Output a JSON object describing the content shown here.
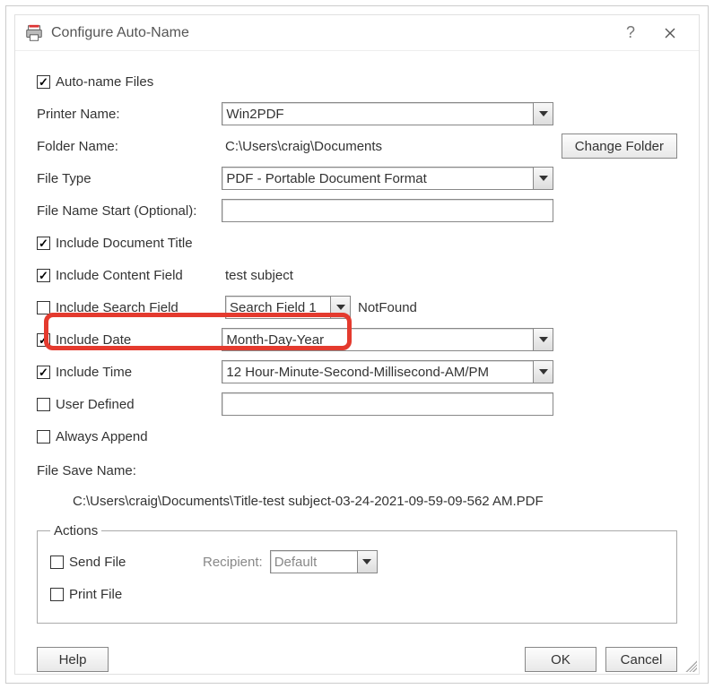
{
  "window": {
    "title": "Configure Auto-Name"
  },
  "fields": {
    "autoNameFiles": {
      "label": "Auto-name Files",
      "checked": true
    },
    "printerName": {
      "label": "Printer Name:",
      "value": "Win2PDF"
    },
    "folderName": {
      "label": "Folder Name:",
      "value": "C:\\Users\\craig\\Documents",
      "button": "Change Folder"
    },
    "fileType": {
      "label": "File Type",
      "value": "PDF - Portable Document Format"
    },
    "fileNameStart": {
      "label": "File Name Start (Optional):",
      "value": ""
    },
    "includeDocTitle": {
      "label": "Include Document Title",
      "checked": true
    },
    "includeContent": {
      "label": "Include Content Field",
      "checked": true,
      "value": "test subject"
    },
    "includeSearch": {
      "label": "Include Search Field",
      "checked": false,
      "combo": "Search Field 1",
      "status": "NotFound"
    },
    "includeDate": {
      "label": "Include Date",
      "checked": true,
      "value": "Month-Day-Year"
    },
    "includeTime": {
      "label": "Include Time",
      "checked": true,
      "value": "12 Hour-Minute-Second-Millisecond-AM/PM"
    },
    "userDefined": {
      "label": "User Defined",
      "checked": false,
      "value": ""
    },
    "alwaysAppend": {
      "label": "Always Append",
      "checked": false
    },
    "fileSaveName": {
      "label": "File Save Name:",
      "preview": "C:\\Users\\craig\\Documents\\Title-test subject-03-24-2021-09-59-09-562 AM.PDF"
    }
  },
  "actions": {
    "legend": "Actions",
    "sendFile": {
      "label": "Send File",
      "checked": false
    },
    "recipient": {
      "label": "Recipient:",
      "value": "Default"
    },
    "printFile": {
      "label": "Print File",
      "checked": false
    }
  },
  "buttons": {
    "help": "Help",
    "ok": "OK",
    "cancel": "Cancel"
  }
}
